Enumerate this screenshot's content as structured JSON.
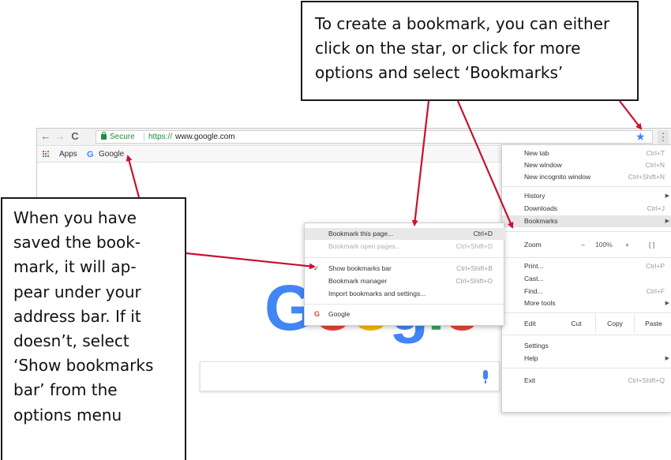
{
  "browser": {
    "nav": {
      "back": "←",
      "forward": "→",
      "reload": "C"
    },
    "omnibox": {
      "secure_label": "Secure",
      "url_scheme": "https://",
      "url_host": "www.google.com"
    },
    "bookmarks_bar": {
      "apps_label": "Apps",
      "google_icon": "G",
      "google_label": "Google"
    },
    "page": {
      "logo_letters": [
        "G",
        "o",
        "o",
        "g",
        "l",
        "e"
      ],
      "logo_colors": [
        "#4285f4",
        "#ea4335",
        "#fbbc05",
        "#4285f4",
        "#34a853",
        "#ea4335"
      ]
    },
    "icons": {
      "star": "★",
      "menu": "⋮"
    }
  },
  "main_menu": {
    "new_tab": {
      "label": "New tab",
      "shortcut": "Ctrl+T"
    },
    "new_window": {
      "label": "New window",
      "shortcut": "Ctrl+N"
    },
    "new_incognito": {
      "label": "New incognito window",
      "shortcut": "Ctrl+Shift+N"
    },
    "history": {
      "label": "History"
    },
    "downloads": {
      "label": "Downloads",
      "shortcut": "Ctrl+J"
    },
    "bookmarks": {
      "label": "Bookmarks"
    },
    "zoom": {
      "label": "Zoom",
      "minus": "–",
      "value": "100%",
      "plus": "+",
      "fullscreen": "[ ]"
    },
    "print": {
      "label": "Print...",
      "shortcut": "Ctrl+P"
    },
    "cast": {
      "label": "Cast..."
    },
    "find": {
      "label": "Find...",
      "shortcut": "Ctrl+F"
    },
    "more_tools": {
      "label": "More tools"
    },
    "edit": {
      "label": "Edit",
      "cut": "Cut",
      "copy": "Copy",
      "paste": "Paste"
    },
    "settings": {
      "label": "Settings"
    },
    "help": {
      "label": "Help"
    },
    "exit": {
      "label": "Exit",
      "shortcut": "Ctrl+Shift+Q"
    },
    "submenu_arrow": "▶"
  },
  "bookmarks_submenu": {
    "bookmark_page": {
      "label": "Bookmark this page...",
      "shortcut": "Ctrl+D"
    },
    "bookmark_open": {
      "label": "Bookmark open pages...",
      "shortcut": "Ctrl+Shift+D"
    },
    "show_bar": {
      "check": "✓",
      "label": "Show bookmarks bar",
      "shortcut": "Ctrl+Shift+B"
    },
    "manager": {
      "label": "Bookmark manager",
      "shortcut": "Ctrl+Shift+O"
    },
    "import": {
      "label": "Import bookmarks and settings..."
    },
    "google": {
      "icon": "G",
      "label": "Google"
    }
  },
  "callouts": {
    "top": [
      "To create a bookmark, you can either",
      "click on the star, or click for more",
      "options and select ‘Bookmarks’"
    ],
    "left": [
      "When you have",
      "saved the book-",
      "mark, it will ap-",
      "pear under your",
      "address bar. If it",
      "doesn’t, select",
      "‘Show bookmarks",
      "bar’ from the",
      "options menu"
    ]
  },
  "colors": {
    "arrow": "#c8102e",
    "secure": "#1e8e3e",
    "star": "#4285f4"
  }
}
